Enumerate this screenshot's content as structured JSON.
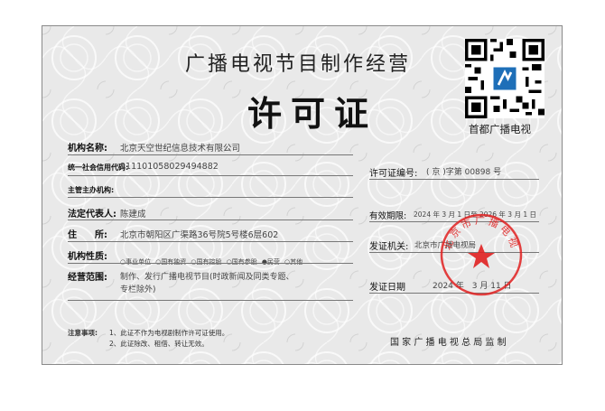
{
  "certificate": {
    "title_line1": "广播电视节目制作经营",
    "title_line2": "许可证",
    "qr_caption": "首都广播电视",
    "fields": {
      "org_name_label": "机构名称:",
      "org_name_value": "北京天空世纪信息技术有限公司",
      "credit_code_label": "统一社会信用代码:",
      "credit_code_value": "911101058029494882",
      "supervisor_label": "主管主办机构:",
      "supervisor_value": "",
      "legal_rep_label": "法定代表人:",
      "legal_rep_value": "陈建成",
      "address_label": "住　　所:",
      "address_value": "北京市朝阳区广渠路36号院5号楼6层602",
      "nature_label": "机构性质:",
      "nature_options": [
        "事业单位",
        "国有独资",
        "国有控股",
        "国有参股",
        "民营",
        "其他"
      ],
      "nature_selected": "民营",
      "scope_label": "经营范围:",
      "scope_value_line1": "制作、发行广播电视节目(时政新闻及同类专题、",
      "scope_value_line2": "专栏除外)"
    },
    "right": {
      "license_no_label": "许可证编号:",
      "license_no_value": "( 京 )字第 00898 号",
      "validity_label": "有效期限:",
      "validity_value": "2024 年 3 月 1 日至 2026 年 3 月 1 日",
      "issuer_label": "发证机关:",
      "issuer_value": "北京市广播电视局",
      "issue_date_label": "发证日期",
      "issue_date_value": "2024 年　3 月 11 日"
    },
    "notes_label": "注意事项:",
    "notes": [
      "1、此证不作为电视剧制作许可证使用。",
      "2、此证除改、租借、转让无效。"
    ],
    "footer": "国 家 广 播 电 视 总 局 监 制",
    "seal_text": "北京市广播电视局",
    "colors": {
      "background": "#e9e9e9",
      "seal": "#e02020",
      "ink": "#222222"
    }
  }
}
